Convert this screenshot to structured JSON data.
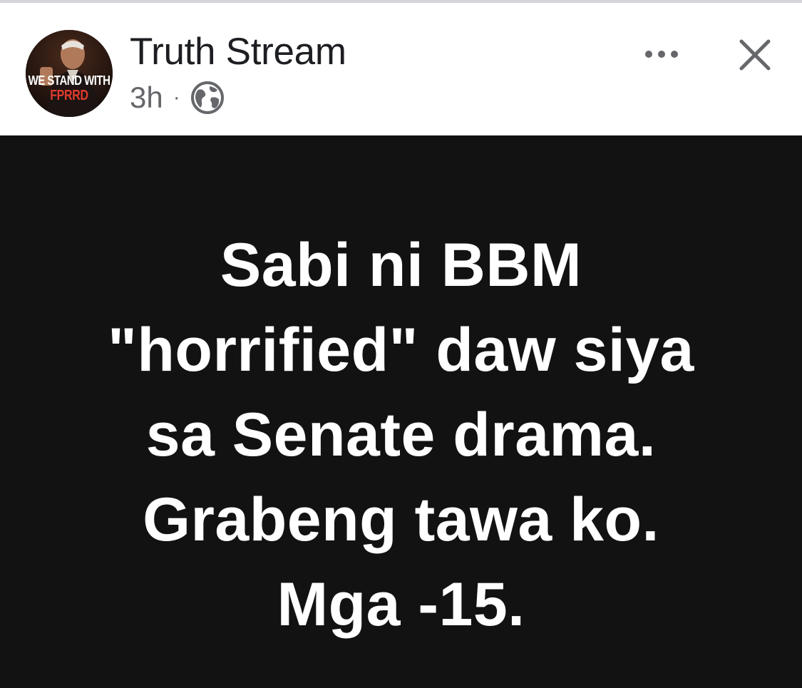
{
  "post": {
    "page_name": "Truth Stream",
    "time": "3h",
    "separator": "·",
    "privacy_icon": "globe-icon",
    "avatar": {
      "icon": "profile-avatar",
      "line1": "WE STAND WITH",
      "line2": "FPRRD"
    },
    "more_icon": "ellipsis-icon",
    "close_icon": "close-icon",
    "body_lines": [
      "Sabi ni BBM",
      "\"horrified\" daw siya",
      "sa Senate drama.",
      "Grabeng tawa ko.",
      "Mga -15."
    ]
  },
  "colors": {
    "header_background": "#ffffff",
    "name_text": "#1c1e21",
    "meta_text": "#65676b",
    "body_background": "#121212",
    "body_text": "#ffffff",
    "avatar_accent": "#e23b2f"
  }
}
